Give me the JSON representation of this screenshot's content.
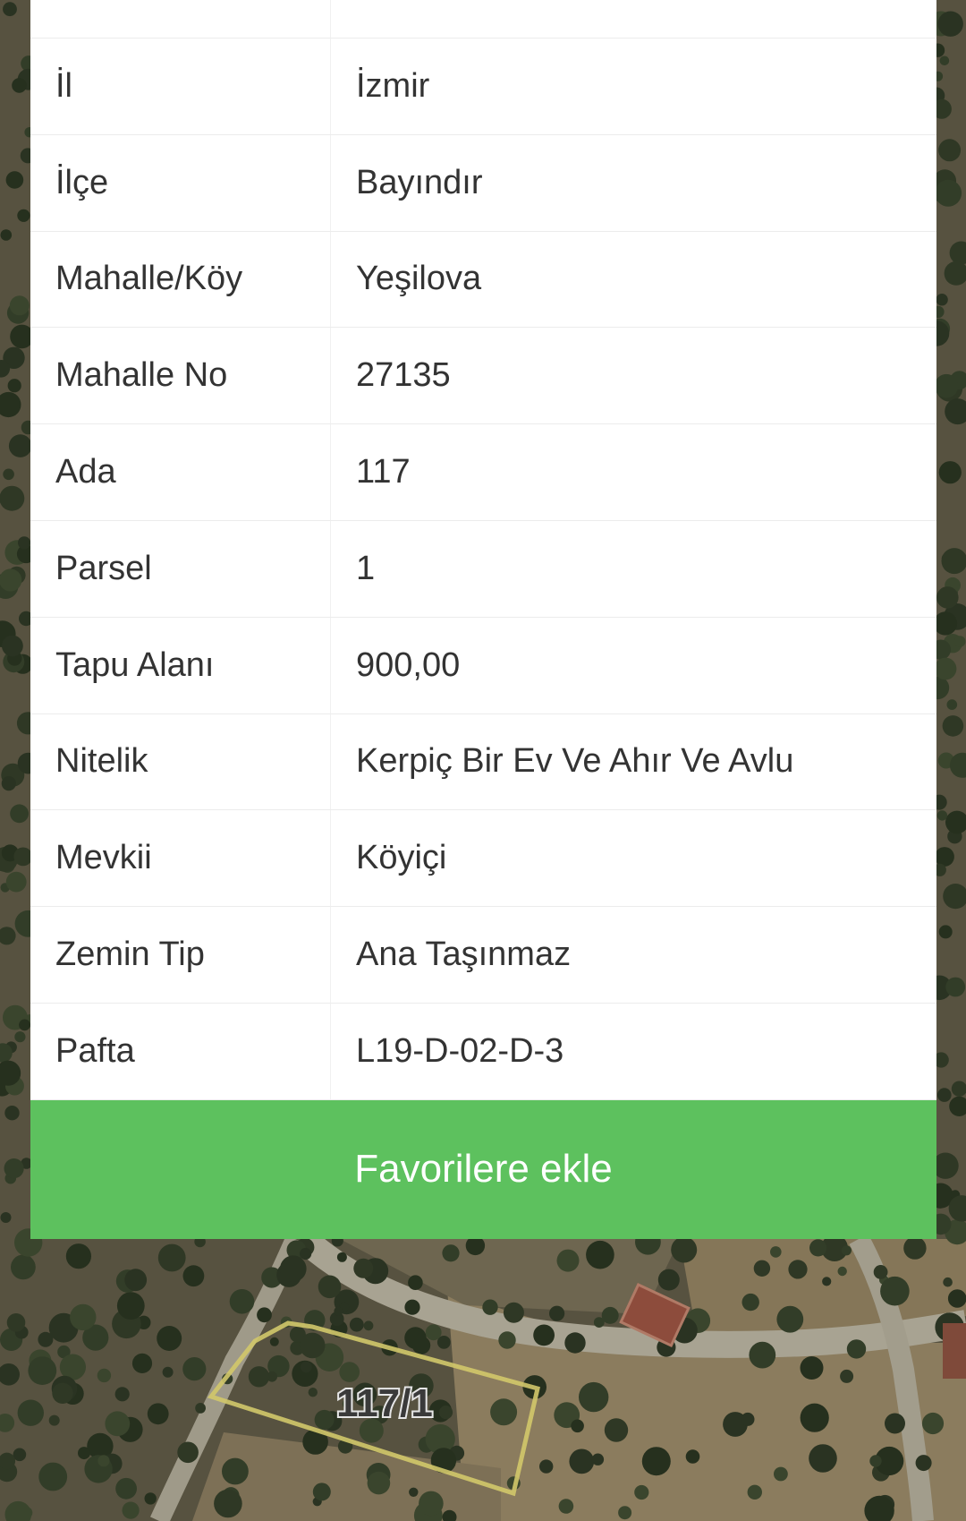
{
  "details": {
    "rows": [
      {
        "label": "İl",
        "value": "İzmir"
      },
      {
        "label": "İlçe",
        "value": "Bayındır"
      },
      {
        "label": "Mahalle/Köy",
        "value": "Yeşilova"
      },
      {
        "label": "Mahalle No",
        "value": "27135"
      },
      {
        "label": "Ada",
        "value": "117"
      },
      {
        "label": "Parsel",
        "value": "1"
      },
      {
        "label": "Tapu Alanı",
        "value": "900,00"
      },
      {
        "label": "Nitelik",
        "value": "Kerpiç Bir Ev Ve Ahır Ve Avlu"
      },
      {
        "label": "Mevkii",
        "value": "Köyiçi"
      },
      {
        "label": "Zemin Tip",
        "value": "Ana Taşınmaz"
      },
      {
        "label": "Pafta",
        "value": "L19-D-02-D-3"
      }
    ]
  },
  "action": {
    "add_favorites_label": "Favorilere ekle"
  },
  "map": {
    "parcel_label": "117/1"
  },
  "colors": {
    "accent": "#5dc15e",
    "text": "#333333",
    "card_background": "#ffffff",
    "parcel_outline": "#d2c86a"
  }
}
